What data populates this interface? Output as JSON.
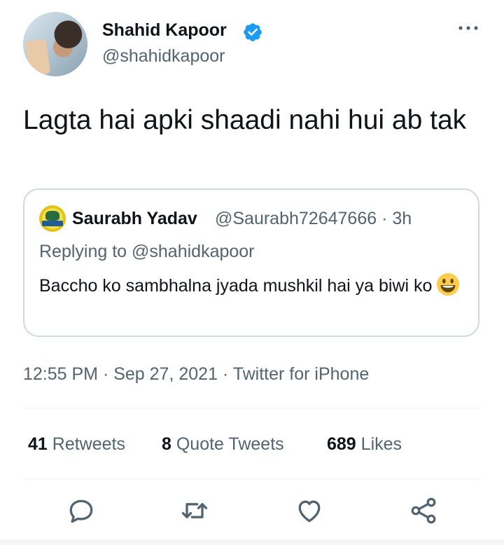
{
  "tweet": {
    "author": {
      "name": "Shahid Kapoor",
      "handle": "@shahidkapoor",
      "verified": true,
      "avatar": "avatar"
    },
    "text": "Lagta hai apki shaadi nahi hui ab tak",
    "quoted": {
      "author_name": "Saurabh Yadav",
      "author_handle": "@Saurabh72647666",
      "time_ago": "3h",
      "meta_separator": " · ",
      "replying_to": "Replying to @shahidkapoor",
      "text": "Baccho ko sambhalna jyada mushkil hai ya biwi ko",
      "emoji": "grinning-face-emoji"
    },
    "timestamp": "12:55 PM · Sep 27, 2021 · Twitter for iPhone",
    "stats": {
      "retweets": {
        "count": "41",
        "label": " Retweets"
      },
      "quote_tweets": {
        "count": "8",
        "label": " Quote Tweets"
      },
      "likes": {
        "count": "689",
        "label": " Likes"
      }
    },
    "actions": [
      "reply-icon",
      "retweet-icon",
      "like-icon",
      "share-icon"
    ]
  },
  "colors": {
    "text_primary": "#0f1419",
    "text_secondary": "#536471",
    "border": "#cfd9de",
    "divider": "#eff3f4",
    "verified_blue": "#1d9bf0"
  }
}
